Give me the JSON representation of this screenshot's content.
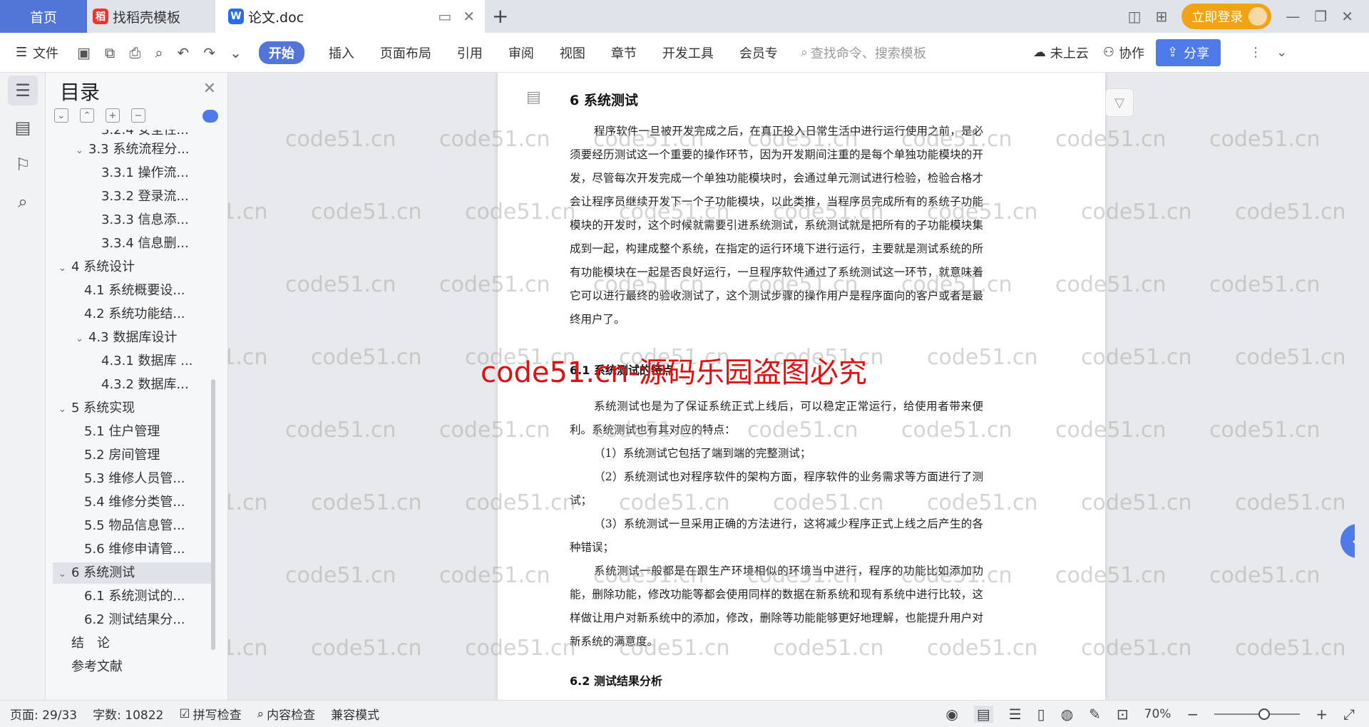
{
  "tabs": {
    "home": "首页",
    "docer": "找稻壳模板",
    "doc": "论文.doc",
    "login": "立即登录"
  },
  "toolbar": {
    "file": "文件",
    "start": "开始",
    "items": [
      "插入",
      "页面布局",
      "引用",
      "审阅",
      "视图",
      "章节",
      "开发工具",
      "会员专"
    ],
    "search": "查找命令、搜索模板",
    "cloud": "未上云",
    "collab": "协作",
    "share": "分享"
  },
  "outline": {
    "title": "目录",
    "items": [
      {
        "label": "3.2.4 安全性...",
        "level": 3,
        "arrow": ""
      },
      {
        "label": "3.3 系统流程分...",
        "level": 2,
        "arrow": "⌄"
      },
      {
        "label": "3.3.1 操作流...",
        "level": 3,
        "arrow": ""
      },
      {
        "label": "3.3.2 登录流...",
        "level": 3,
        "arrow": ""
      },
      {
        "label": "3.3.3 信息添...",
        "level": 3,
        "arrow": ""
      },
      {
        "label": "3.3.4 信息删...",
        "level": 3,
        "arrow": ""
      },
      {
        "label": "4 系统设计",
        "level": 1,
        "arrow": "⌄"
      },
      {
        "label": "4.1 系统概要设...",
        "level": 2,
        "arrow": ""
      },
      {
        "label": "4.2 系统功能结...",
        "level": 2,
        "arrow": ""
      },
      {
        "label": "4.3 数据库设计",
        "level": 2,
        "arrow": "⌄"
      },
      {
        "label": "4.3.1 数据库 ...",
        "level": 3,
        "arrow": ""
      },
      {
        "label": "4.3.2 数据库...",
        "level": 3,
        "arrow": ""
      },
      {
        "label": "5 系统实现",
        "level": 1,
        "arrow": "⌄"
      },
      {
        "label": "5.1 住户管理",
        "level": 2,
        "arrow": ""
      },
      {
        "label": "5.2 房间管理",
        "level": 2,
        "arrow": ""
      },
      {
        "label": "5.3 维修人员管...",
        "level": 2,
        "arrow": ""
      },
      {
        "label": "5.4 维修分类管...",
        "level": 2,
        "arrow": ""
      },
      {
        "label": "5.5 物品信息管...",
        "level": 2,
        "arrow": ""
      },
      {
        "label": "5.6 维修申请管...",
        "level": 2,
        "arrow": ""
      },
      {
        "label": "6 系统测试",
        "level": 1,
        "arrow": "⌄",
        "selected": true
      },
      {
        "label": "6.1 系统测试的...",
        "level": 2,
        "arrow": ""
      },
      {
        "label": "6.2 测试结果分...",
        "level": 2,
        "arrow": ""
      },
      {
        "label": "结　论",
        "level": 1,
        "arrow": ""
      },
      {
        "label": "参考文献",
        "level": 1,
        "arrow": ""
      }
    ]
  },
  "document": {
    "h1": "6  系统测试",
    "p1": "程序软件一旦被开发完成之后，在真正投入日常生活中进行运行使用之前，是必须要经历测试这一个重要的操作环节，因为开发期间注重的是每个单独功能模块的开发，尽管每次开发完成一个单独功能模块时，会通过单元测试进行检验，检验合格才会让程序员继续开发下一个子功能模块，以此类推，当程序员完成所有的系统子功能模块的开发时，这个时候就需要引进系统测试，系统测试就是把所有的子功能模块集成到一起，构建成整个系统，在指定的运行环境下进行运行，主要就是测试系统的所有功能模块在一起是否良好运行，一旦程序软件通过了系统测试这一环节，就意味着它可以进行最终的验收测试了，这个测试步骤的操作用户是程序面向的客户或者是最终用户了。",
    "h2a": "6.1  系统测试的特点",
    "p2": "系统测试也是为了保证系统正式上线后，可以稳定正常运行，给使用者带来便利。系统测试也有其对应的特点：",
    "p3": "（1）系统测试它包括了端到端的完整测试；",
    "p4": "（2）系统测试也对程序软件的架构方面，程序软件的业务需求等方面进行了测试；",
    "p5": "（3）系统测试一旦采用正确的方法进行，这将减少程序正式上线之后产生的各种错误；",
    "p6": "系统测试一般都是在跟生产环境相似的环境当中进行，程序的功能比如添加功能，删除功能，修改功能等都会使用同样的数据在新系统和现有系统中进行比较，这样做让用户对新系统中的添加，修改，删除等功能能够更好地理解，也能提升用户对新系统的满意度。",
    "h2b": "6.2  测试结果分析"
  },
  "watermark": {
    "text": "code51.cn",
    "big": "code51.cn-源码乐园盗图必究"
  },
  "status": {
    "page": "页面: 29/33",
    "words": "字数: 10822",
    "spell": "拼写检查",
    "content": "内容检查",
    "compat": "兼容模式",
    "zoom": "70%"
  }
}
